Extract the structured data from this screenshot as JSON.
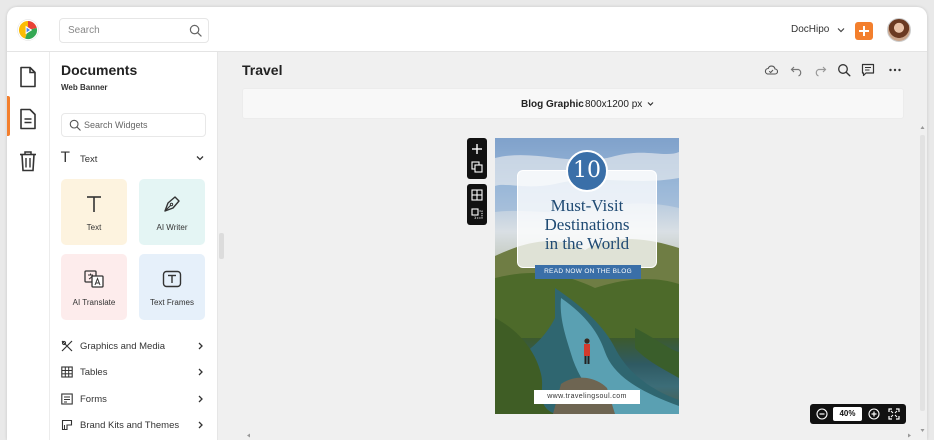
{
  "header": {
    "search_placeholder": "Search",
    "workspace": "DocHipo",
    "colors": {
      "accent": "#f37f2d"
    }
  },
  "rail": {
    "icons": [
      "document-icon",
      "page-icon",
      "trash-icon"
    ],
    "active_index": 1
  },
  "panel": {
    "title": "Documents",
    "subtitle": "Web Banner",
    "search_placeholder": "Search Widgets",
    "section": "Text",
    "cards": [
      {
        "label": "Text",
        "icon": "text-t-icon",
        "color": "#fdf3df"
      },
      {
        "label": "AI Writer",
        "icon": "pen-nib-icon",
        "color": "#e4f5f4"
      },
      {
        "label": "AI Translate",
        "icon": "translate-icon",
        "color": "#fdecec"
      },
      {
        "label": "Text Frames",
        "icon": "text-frame-icon",
        "color": "#e6f0fa"
      }
    ],
    "menu": [
      {
        "label": "Graphics and Media",
        "icon": "graphics-icon"
      },
      {
        "label": "Tables",
        "icon": "table-icon"
      },
      {
        "label": "Forms",
        "icon": "form-icon"
      },
      {
        "label": "Brand Kits and Themes",
        "icon": "brand-kit-icon"
      }
    ]
  },
  "canvas": {
    "doc_title": "Travel",
    "tools": [
      "cloud-save-icon",
      "undo-icon",
      "redo-icon",
      "zoom-search-icon",
      "comment-icon",
      "more-icon"
    ],
    "size_label": "Blog Graphic",
    "size_value": "800x1200 px",
    "zoom": "40%"
  },
  "poster": {
    "number": "10",
    "headline_1": "Must-Visit",
    "headline_2": "Destinations",
    "headline_3": "in the World",
    "cta": "READ NOW ON THE BLOG",
    "url": "www.travelingsoul.com"
  }
}
